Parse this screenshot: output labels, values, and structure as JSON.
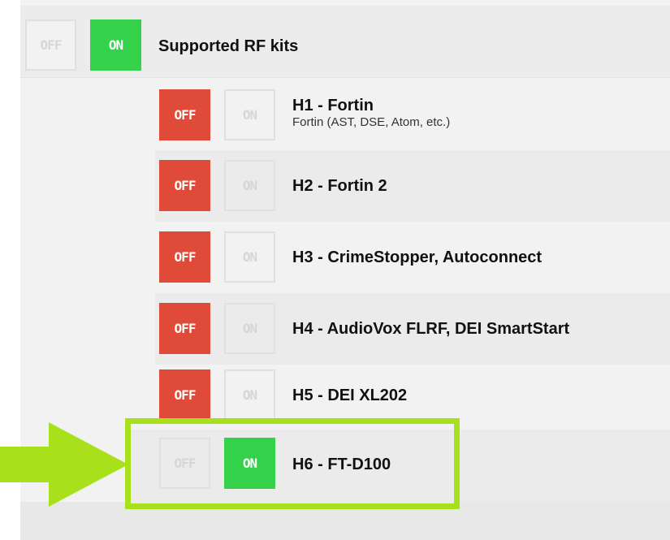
{
  "master": {
    "off_label": "OFF",
    "on_label": "ON",
    "title": "Supported RF kits",
    "state": "on"
  },
  "kits": [
    {
      "off_label": "OFF",
      "on_label": "ON",
      "title": "H1 - Fortin",
      "subtitle": "Fortin (AST, DSE, Atom, etc.)",
      "state": "off"
    },
    {
      "off_label": "OFF",
      "on_label": "ON",
      "title": "H2 - Fortin 2",
      "state": "off"
    },
    {
      "off_label": "OFF",
      "on_label": "ON",
      "title": "H3 - CrimeStopper, Autoconnect",
      "state": "off"
    },
    {
      "off_label": "OFF",
      "on_label": "ON",
      "title": "H4 - AudioVox FLRF, DEI SmartStart",
      "state": "off"
    },
    {
      "off_label": "OFF",
      "on_label": "ON",
      "title": "H5 - DEI XL202",
      "state": "off"
    },
    {
      "off_label": "OFF",
      "on_label": "ON",
      "title": "H6 - FT-D100",
      "state": "on"
    }
  ],
  "colors": {
    "off_active": "#e04a38",
    "on_active": "#34d14b",
    "highlight": "#a8e01c"
  },
  "icons": {
    "pointer": "arrow-right-icon"
  }
}
